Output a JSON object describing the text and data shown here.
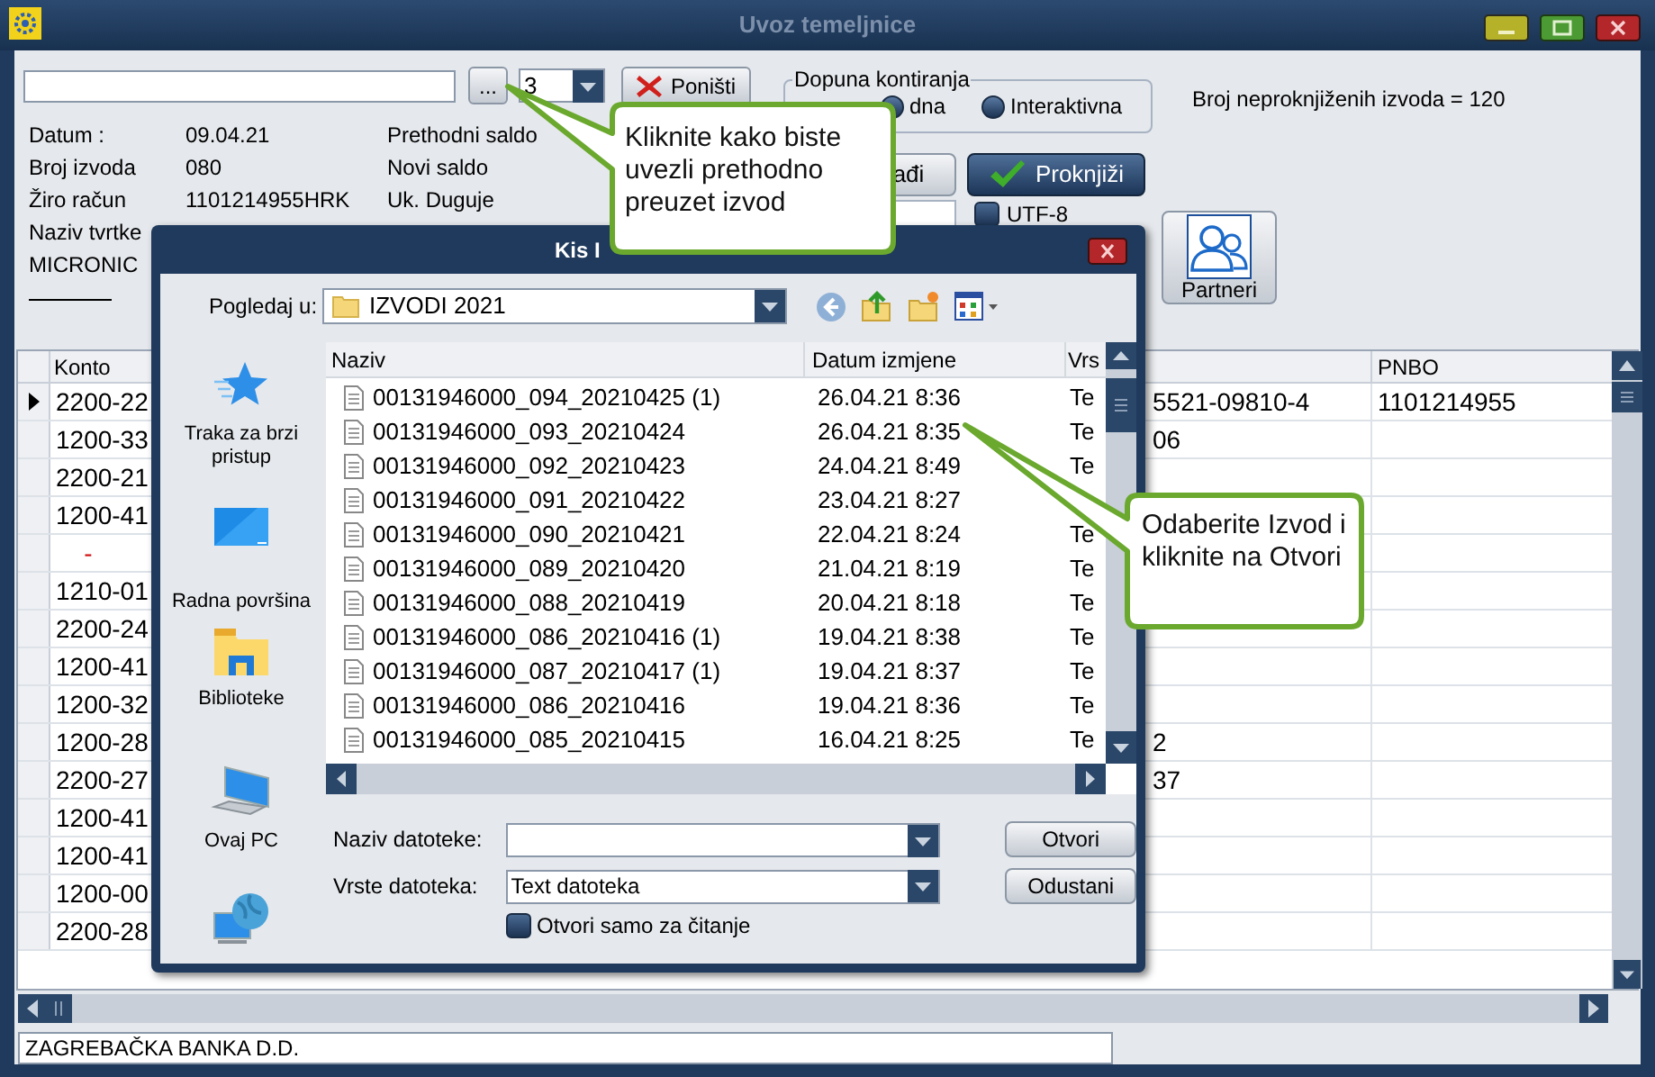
{
  "window": {
    "title": "Uvoz temeljnice"
  },
  "toolbar": {
    "browse_button": "...",
    "count_combo": "3",
    "cancel_button": "Poništi"
  },
  "dopuna": {
    "title": "Dopuna kontiranja",
    "options": [
      {
        "label": "dna",
        "selected": false
      },
      {
        "label": "Interaktivna",
        "selected": false
      }
    ]
  },
  "unposted_count": "Broj neproknjiženih izvoda = 120",
  "info": {
    "labels": [
      "Datum :",
      "Broj izvoda",
      "Žiro račun",
      "Naziv tvrtke",
      "MICRONIC"
    ],
    "values": [
      "09.04.21",
      "080",
      "1101214955HRK"
    ],
    "totals": [
      "Prethodni saldo",
      "Novi saldo",
      "Uk. Duguje"
    ]
  },
  "buttons": [
    {
      "label": "ađi",
      "kind": "plain"
    },
    {
      "label": "Proknjiži",
      "kind": "primary"
    }
  ],
  "utf8": {
    "label": "UTF-8",
    "checked": false
  },
  "partners_button": "Partneri",
  "table": {
    "columns": [
      "Konto",
      "PNBO"
    ],
    "rows": [
      {
        "konto": "2200-22",
        "column_3": "5521-09810-4",
        "pnbo": "1101214955",
        "current": true,
        "marked": false
      },
      {
        "konto": "1200-33",
        "column_3": "06",
        "current": false,
        "marked": false
      },
      {
        "konto": "2200-21",
        "current": false,
        "marked": false
      },
      {
        "konto": "1200-41",
        "current": false,
        "marked": false
      },
      {
        "konto": "-",
        "current": false,
        "marked": true
      },
      {
        "konto": "1210-01",
        "current": false,
        "marked": false
      },
      {
        "konto": "2200-24",
        "current": false,
        "marked": false
      },
      {
        "konto": "1200-41",
        "current": false,
        "marked": false
      },
      {
        "konto": "1200-32",
        "current": false,
        "marked": false
      },
      {
        "konto": "1200-28",
        "column_3": "2",
        "current": false,
        "marked": false
      },
      {
        "konto": "2200-27",
        "column_3": "37",
        "current": false,
        "marked": false
      },
      {
        "konto": "1200-41",
        "current": false,
        "marked": false
      },
      {
        "konto": "1200-41",
        "current": false,
        "marked": false
      },
      {
        "konto": "1200-00",
        "current": false,
        "marked": false
      },
      {
        "konto": "2200-28",
        "current": false,
        "marked": false
      }
    ]
  },
  "status_field": "ZAGREBAČKA BANKA D.D.",
  "dialog": {
    "title": "Kis I",
    "look_in_label": "Pogledaj u:",
    "folder": "IZVODI 2021",
    "places": [
      {
        "label": "Traka za brzi pristup",
        "kind": "star"
      },
      {
        "label": "Radna površina",
        "kind": "desktop"
      },
      {
        "label": "Biblioteke",
        "kind": "library"
      },
      {
        "label": "Ovaj PC",
        "kind": "pc"
      },
      {
        "kind": "network"
      }
    ],
    "columns": [
      "Naziv",
      "Datum izmjene",
      "Vrs"
    ],
    "files": [
      {
        "name": "00131946000_094_20210425 (1)",
        "date": "26.04.21 8:36",
        "type": "Te"
      },
      {
        "name": "00131946000_093_20210424",
        "date": "26.04.21 8:35",
        "type": "Te"
      },
      {
        "name": "00131946000_092_20210423",
        "date": "24.04.21 8:49",
        "type": "Te"
      },
      {
        "name": "00131946000_091_20210422",
        "date": "23.04.21 8:27"
      },
      {
        "name": "00131946000_090_20210421",
        "date": "22.04.21 8:24",
        "type": "Te"
      },
      {
        "name": "00131946000_089_20210420",
        "date": "21.04.21 8:19",
        "type": "Te"
      },
      {
        "name": "00131946000_088_20210419",
        "date": "20.04.21 8:18",
        "type": "Te"
      },
      {
        "name": "00131946000_086_20210416 (1)",
        "date": "19.04.21 8:38",
        "type": "Te"
      },
      {
        "name": "00131946000_087_20210417 (1)",
        "date": "19.04.21 8:37",
        "type": "Te"
      },
      {
        "name": "00131946000_086_20210416",
        "date": "19.04.21 8:36",
        "type": "Te"
      },
      {
        "name": "00131946000_085_20210415",
        "date": "16.04.21 8:25",
        "type": "Te"
      }
    ],
    "file_name_label": "Naziv datoteke:",
    "file_type_label": "Vrste datoteka:",
    "file_type": "Text datoteka",
    "readonly": {
      "label": "Otvori samo za čitanje",
      "checked": false
    },
    "buttons": [
      "Otvori",
      "Odustani"
    ]
  },
  "callouts": [
    {
      "text": "Kliknite kako biste uvezli prethodno preuzet izvod"
    },
    {
      "text": "Odaberite Izvod i kliknite na Otvori"
    }
  ]
}
